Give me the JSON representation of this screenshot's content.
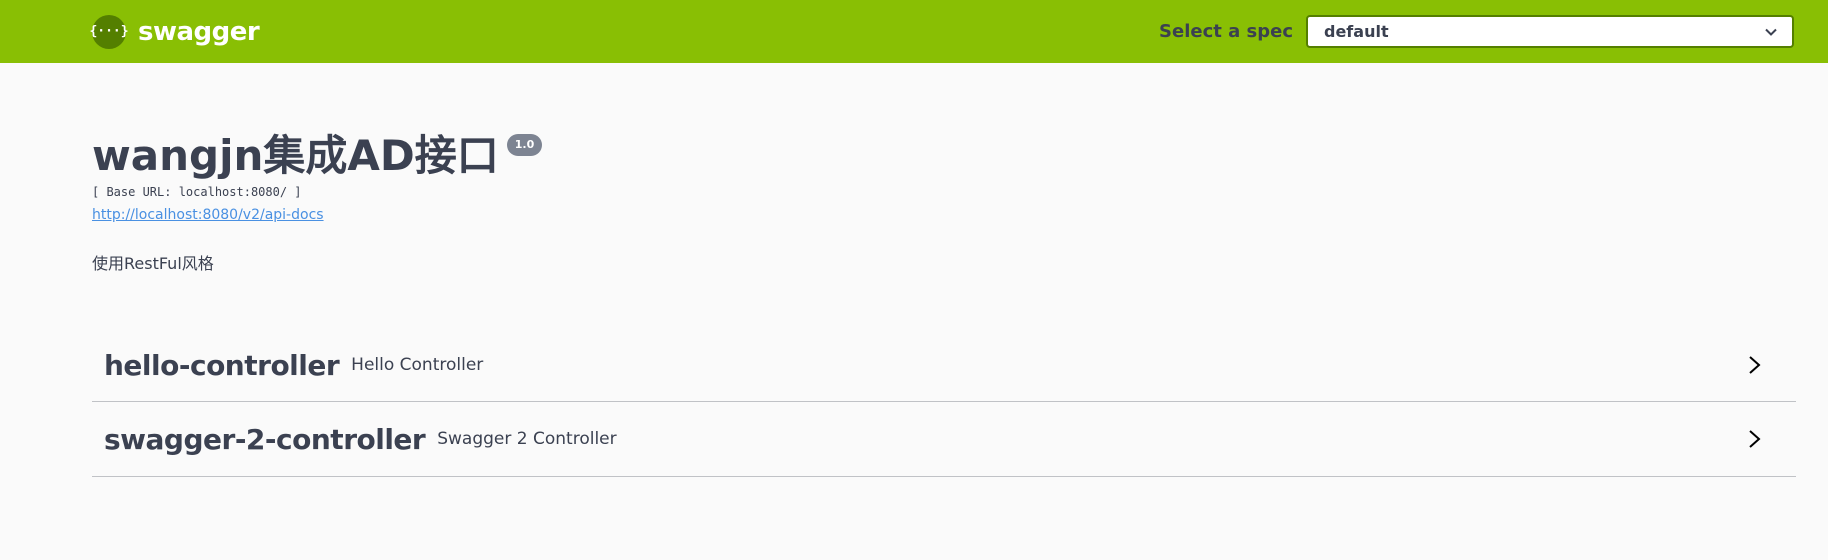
{
  "topbar": {
    "logo_glyph": "{···}",
    "brand_name": "swagger",
    "brand_color": "#89bf04",
    "spec_label": "Select a spec",
    "spec_selected": "default"
  },
  "info": {
    "title": "wangjn集成AD接口",
    "version": "1.0",
    "base_url": "[ Base URL: localhost:8080/ ]",
    "api_docs_link": "http://localhost:8080/v2/api-docs",
    "description": "使用RestFul风格"
  },
  "tags": [
    {
      "name": "hello-controller",
      "description": "Hello Controller",
      "icon": "chevron-right-icon"
    },
    {
      "name": "swagger-2-controller",
      "description": "Swagger 2 Controller",
      "icon": "chevron-right-icon"
    }
  ]
}
